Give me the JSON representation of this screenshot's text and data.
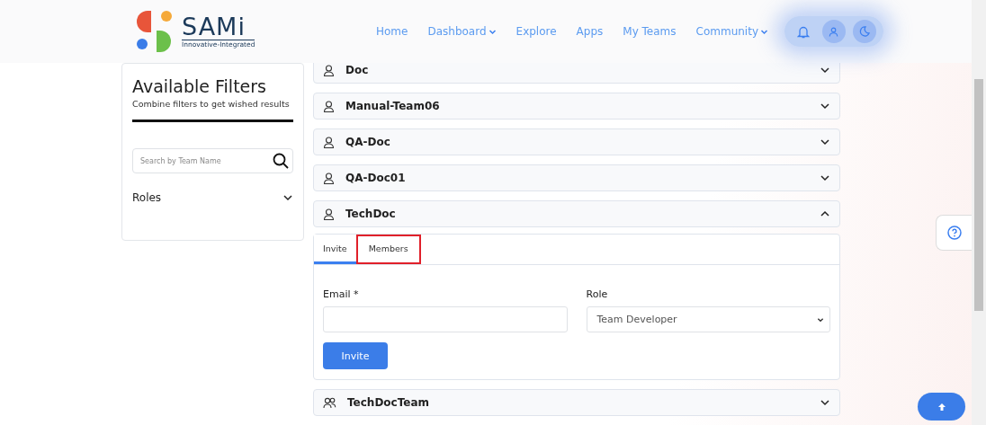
{
  "header": {
    "logo": {
      "name": "SAMi",
      "tagline": "Innovative-Integrated"
    },
    "nav": [
      {
        "label": "Home",
        "dropdown": false
      },
      {
        "label": "Dashboard",
        "dropdown": true
      },
      {
        "label": "Explore",
        "dropdown": false
      },
      {
        "label": "Apps",
        "dropdown": false
      },
      {
        "label": "My Teams",
        "dropdown": false
      },
      {
        "label": "Community",
        "dropdown": true
      }
    ]
  },
  "filters": {
    "title": "Available Filters",
    "subtitle": "Combine filters to get wished results",
    "search": {
      "placeholder": "Search by Team Name"
    },
    "sections": [
      {
        "label": "Roles",
        "expanded": false
      }
    ]
  },
  "teams": [
    {
      "name": "Doc",
      "kind": "single",
      "expanded": false
    },
    {
      "name": "Manual-Team06",
      "kind": "single",
      "expanded": false
    },
    {
      "name": "QA-Doc",
      "kind": "single",
      "expanded": false
    },
    {
      "name": "QA-Doc01",
      "kind": "single",
      "expanded": false
    },
    {
      "name": "TechDoc",
      "kind": "single",
      "expanded": true,
      "tabs": [
        {
          "label": "Invite",
          "selected": true,
          "highlighted": false
        },
        {
          "label": "Members",
          "selected": false,
          "highlighted": true
        }
      ],
      "form": {
        "email_label": "Email *",
        "role_label": "Role",
        "role_value": "Team Developer",
        "submit": "Invite"
      }
    },
    {
      "name": "TechDocTeam",
      "kind": "group",
      "expanded": false
    }
  ]
}
